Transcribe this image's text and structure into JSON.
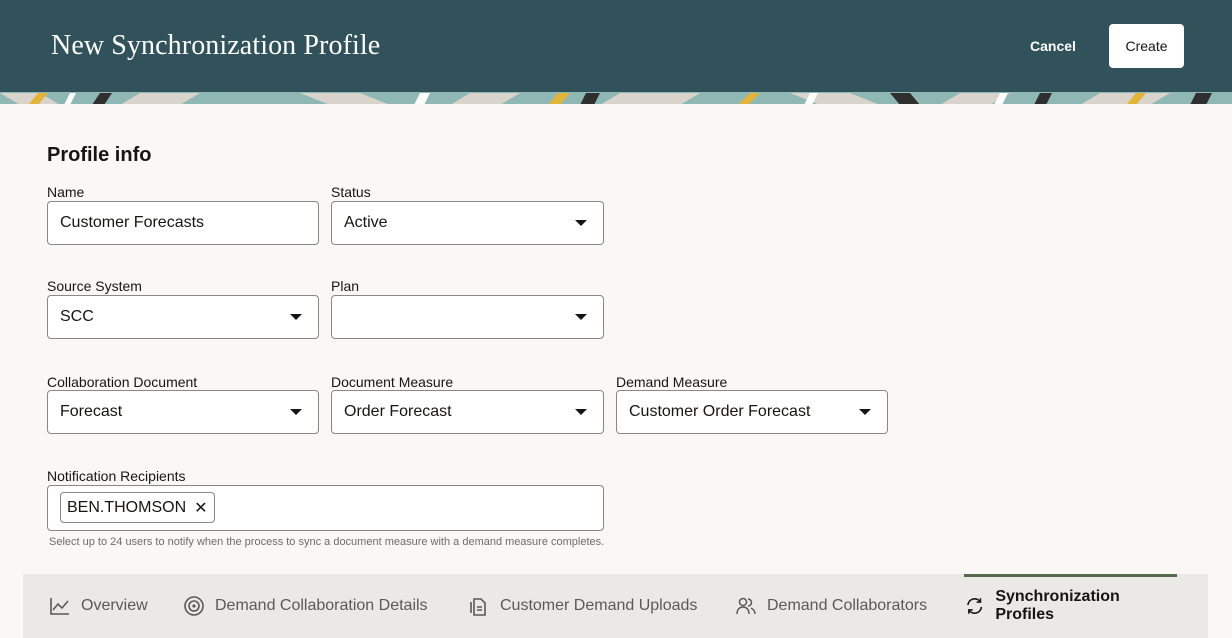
{
  "header": {
    "title": "New Synchronization Profile",
    "cancel_label": "Cancel",
    "create_label": "Create"
  },
  "section": {
    "title": "Profile info"
  },
  "form": {
    "name": {
      "label": "Name",
      "value": "Customer Forecasts"
    },
    "status": {
      "label": "Status",
      "value": "Active"
    },
    "source_system": {
      "label": "Source System",
      "value": "SCC"
    },
    "plan": {
      "label": "Plan",
      "value": ""
    },
    "collaboration_document": {
      "label": "Collaboration Document",
      "value": "Forecast"
    },
    "document_measure": {
      "label": "Document Measure",
      "value": "Order Forecast"
    },
    "demand_measure": {
      "label": "Demand Measure",
      "value": "Customer Order Forecast"
    },
    "notification_recipients": {
      "label": "Notification Recipients",
      "chips": [
        "BEN.THOMSON"
      ],
      "helper": "Select up to 24 users to notify when the process to sync a document measure with a demand measure completes."
    }
  },
  "tabs": [
    {
      "label": "Overview",
      "icon": "line-chart-icon"
    },
    {
      "label": "Demand Collaboration Details",
      "icon": "target-icon"
    },
    {
      "label": "Customer Demand Uploads",
      "icon": "document-icon"
    },
    {
      "label": "Demand Collaborators",
      "icon": "users-icon"
    },
    {
      "label": "Synchronization Profiles",
      "icon": "sync-icon",
      "active": true
    }
  ],
  "colors": {
    "header_bg": "#31525a",
    "page_bg": "#f9f8f6",
    "tabbar_bg": "#ebe9e6",
    "active_tab_indicator": "#566b4e"
  }
}
